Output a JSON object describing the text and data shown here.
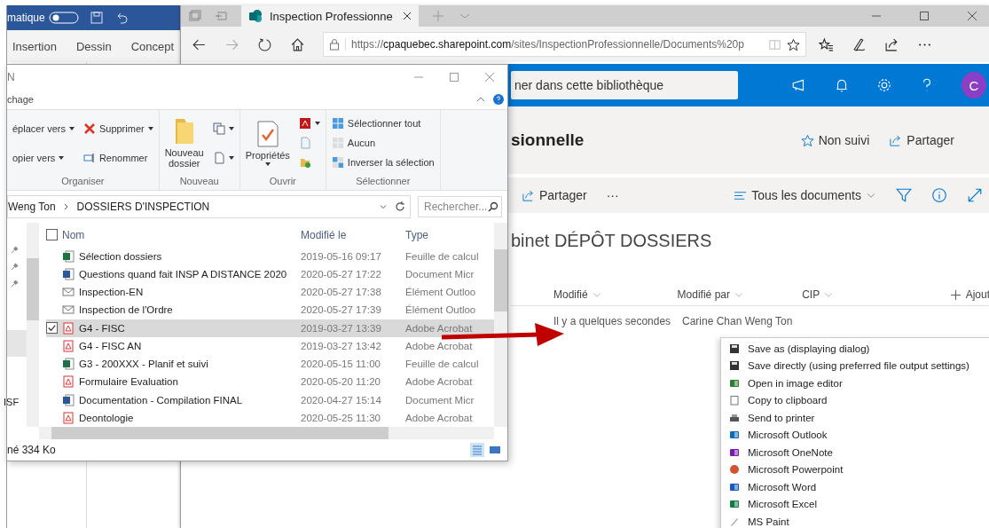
{
  "word_window": {
    "title_fragment": "matique",
    "ribbon_tabs": [
      "Insertion",
      "Dessin",
      "Concept"
    ]
  },
  "browser": {
    "tab_title": "Inspection Professionne",
    "url_scheme": "https://",
    "url_host": "cpaquebec.sharepoint.com",
    "url_path": "/sites/InspectionProfessionnelle/Documents%20p"
  },
  "sharepoint": {
    "search_placeholder": "ner dans cette bibliothèque",
    "avatar": "C",
    "site_title": "sionnelle",
    "follow": "Non suivi",
    "share": "Partager",
    "command_share": "Partager",
    "command_more": "···",
    "view": "Tous les documents",
    "library_title": "binet DÉPÔT DOSSIERS",
    "columns": [
      {
        "label": "Modifié",
        "sortable": true
      },
      {
        "label": "Modifié par",
        "sortable": true
      },
      {
        "label": "CIP",
        "sortable": true
      },
      {
        "label": "Ajout",
        "sortable": false
      }
    ],
    "rows": [
      {
        "modified": "Il y a quelques secondes",
        "modified_by": "Carine Chan Weng Ton"
      }
    ]
  },
  "explorer": {
    "title": "N",
    "ribbon_tab": "chage",
    "ribbon_groups": [
      {
        "label": "Organiser",
        "columns": [
          [
            {
              "label_lines": [
                "éplacer vers"
              ],
              "kind": "move",
              "dropdown": true
            },
            {
              "label_lines": [
                "opier vers"
              ],
              "kind": "copy",
              "dropdown": true
            }
          ],
          [
            {
              "label_lines": [
                "Supprimer"
              ],
              "kind": "delete",
              "dropdown": true
            },
            {
              "label_lines": [
                "Renommer"
              ],
              "kind": "rename",
              "dropdown": false
            }
          ]
        ]
      },
      {
        "label": "Nouveau",
        "columns": [
          [
            {
              "label_lines": [
                "Nouveau",
                "dossier"
              ],
              "kind": "folder",
              "dropdown": false
            }
          ],
          [
            {
              "kind": "new-item",
              "dropdown": true
            },
            {
              "kind": "easy-access",
              "dropdown": true
            }
          ]
        ]
      },
      {
        "label": "Ouvrir",
        "columns": [
          [
            {
              "label_lines": [
                "Propriétés"
              ],
              "kind": "properties",
              "dropdown": true
            }
          ],
          [
            {
              "kind": "pdf",
              "dropdown": true
            },
            {
              "kind": "edit",
              "dropdown": false
            },
            {
              "kind": "history",
              "dropdown": false
            }
          ]
        ]
      },
      {
        "label": "Sélectionner",
        "columns": [
          [
            {
              "label_lines": [
                "Sélectionner tout"
              ],
              "kind": "select-all",
              "dropdown": false
            },
            {
              "label_lines": [
                "Aucun"
              ],
              "kind": "select-none",
              "dropdown": false
            },
            {
              "label_lines": [
                "Inverser la sélection"
              ],
              "kind": "invert",
              "dropdown": false
            }
          ]
        ]
      }
    ],
    "path": [
      "Weng Ton",
      "DOSSIERS D'INSPECTION"
    ],
    "search_placeholder": "Rechercher...",
    "nav_items": [
      {
        "label": "ISF"
      }
    ],
    "columns": [
      "Nom",
      "Modifié le",
      "Type"
    ],
    "all_checked": false,
    "files": [
      {
        "name": "Sélection dossiers",
        "modified": "2019-05-16 09:17",
        "type": "Feuille de calcul",
        "kind": "excel",
        "selected": false
      },
      {
        "name": "Questions quand fait INSP A DISTANCE 2020",
        "modified": "2020-05-27 17:22",
        "type": "Document Micr",
        "kind": "word",
        "selected": false
      },
      {
        "name": "Inspection-EN",
        "modified": "2020-05-27 17:38",
        "type": "Élément Outloo",
        "kind": "mail",
        "selected": false
      },
      {
        "name": "Inspection de l'Ordre",
        "modified": "2020-05-27 17:39",
        "type": "Élément Outloo",
        "kind": "mail",
        "selected": false
      },
      {
        "name": "G4 - FISC",
        "modified": "2019-03-27 13:39",
        "type": "Adobe Acrobat",
        "kind": "pdf",
        "selected": true
      },
      {
        "name": "G4 - FISC AN",
        "modified": "2019-03-27 13:42",
        "type": "Adobe Acrobat",
        "kind": "pdf",
        "selected": false
      },
      {
        "name": "G3 - 200XXX - Planif et suivi",
        "modified": "2020-05-15 11:00",
        "type": "Feuille de calcul",
        "kind": "excel",
        "selected": false
      },
      {
        "name": "Formulaire Evaluation",
        "modified": "2020-05-20 11:20",
        "type": "Adobe Acrobat",
        "kind": "pdf",
        "selected": false
      },
      {
        "name": "Documentation - Compilation FINAL",
        "modified": "2020-04-27 15:14",
        "type": "Document Micr",
        "kind": "word",
        "selected": false
      },
      {
        "name": "Deontologie",
        "modified": "2020-05-25 11:30",
        "type": "Adobe Acrobat",
        "kind": "pdf",
        "selected": false
      }
    ],
    "status": "né 334 Ko"
  },
  "context_menu": {
    "items": [
      {
        "label": "Save as (displaying dialog)",
        "kind": "save"
      },
      {
        "label": "Save directly (using preferred file output settings)",
        "kind": "save"
      },
      {
        "label": "Open in image editor",
        "kind": "image-editor"
      },
      {
        "label": "Copy to clipboard",
        "kind": "clipboard"
      },
      {
        "label": "Send to printer",
        "kind": "printer"
      },
      {
        "label": "Microsoft Outlook",
        "kind": "outlook"
      },
      {
        "label": "Microsoft OneNote",
        "kind": "onenote"
      },
      {
        "label": "Microsoft Powerpoint",
        "kind": "powerpoint"
      },
      {
        "label": "Microsoft Word",
        "kind": "word"
      },
      {
        "label": "Microsoft Excel",
        "kind": "excel"
      },
      {
        "label": "MS Paint",
        "kind": "paint"
      }
    ]
  }
}
